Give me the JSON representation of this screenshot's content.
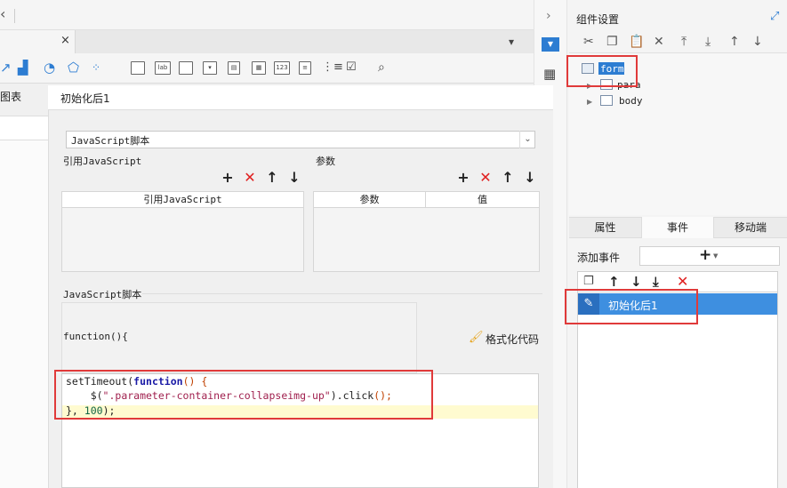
{
  "designer": {
    "chart_label": "图表",
    "tab_close": "×",
    "widget_toolbar": [
      "lab",
      "123"
    ]
  },
  "dialog": {
    "title": "初始化后1",
    "type_select_value": "JavaScript脚本",
    "ref_js_label": "引用JavaScript",
    "params_label": "参数",
    "ref_js_column": "引用JavaScript",
    "param_columns": [
      "参数",
      "值"
    ],
    "js_section_label": "JavaScript脚本",
    "func_text": "function(){",
    "format_button": "格式化代码",
    "code": {
      "l1_a": "setTimeout(",
      "l1_kw": "function",
      "l1_b": "() {",
      "l2_a": "    $(",
      "l2_str": "\".parameter-container-collapseimg-up\"",
      "l2_b": ").click",
      "l2_c": "();",
      "l3_a": "}, ",
      "l3_num": "100",
      "l3_b": ");"
    }
  },
  "right_panel": {
    "title": "组件设置",
    "tree": [
      "form",
      "para",
      "body"
    ],
    "tabs": [
      "属性",
      "事件",
      "移动端"
    ],
    "add_event_label": "添加事件",
    "add_event_symbol": "+",
    "event_item": "初始化后1"
  },
  "colors": {
    "accent": "#2d7dd2",
    "highlight_box": "#e03a3a",
    "delete_red": "#e02020"
  }
}
